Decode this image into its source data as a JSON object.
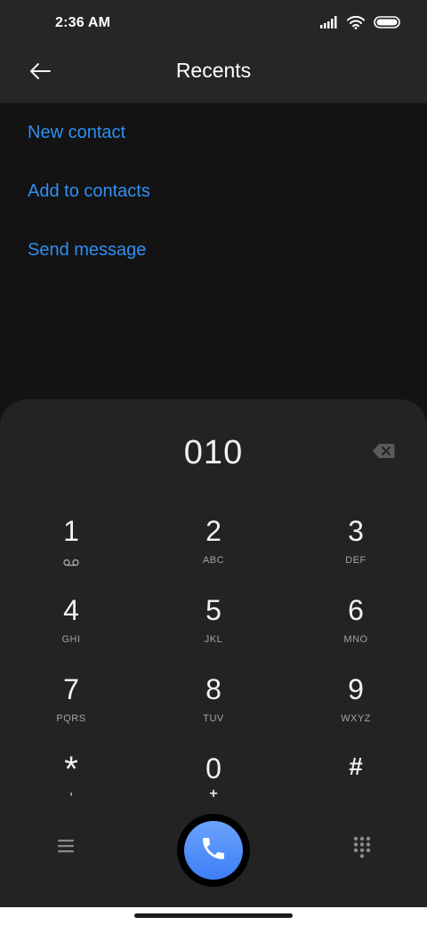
{
  "status_bar": {
    "time": "2:36 AM",
    "icons": [
      "signal-icon",
      "wifi-icon",
      "battery-icon"
    ]
  },
  "header": {
    "title": "Recents",
    "back_icon": "back-arrow-icon"
  },
  "actions": [
    {
      "label": "New contact"
    },
    {
      "label": "Add to contacts"
    },
    {
      "label": "Send message"
    }
  ],
  "dialpad": {
    "number": "010",
    "backspace_icon": "backspace-icon",
    "keys": [
      {
        "digit": "1",
        "letters": "",
        "sub_icon": "voicemail-icon"
      },
      {
        "digit": "2",
        "letters": "ABC"
      },
      {
        "digit": "3",
        "letters": "DEF"
      },
      {
        "digit": "4",
        "letters": "GHI"
      },
      {
        "digit": "5",
        "letters": "JKL"
      },
      {
        "digit": "6",
        "letters": "MNO"
      },
      {
        "digit": "7",
        "letters": "PQRS"
      },
      {
        "digit": "8",
        "letters": "TUV"
      },
      {
        "digit": "9",
        "letters": "WXYZ"
      },
      {
        "digit": "*",
        "letters": ","
      },
      {
        "digit": "0",
        "letters": "+"
      },
      {
        "digit": "#",
        "letters": ""
      }
    ]
  },
  "bottom": {
    "menu_icon": "menu-icon",
    "call_icon": "phone-icon",
    "dialpad_icon": "dialpad-icon"
  },
  "colors": {
    "accent": "#2f8ff3",
    "call_button": "#4f8ff8",
    "background": "#131313",
    "sheet": "#232323"
  }
}
